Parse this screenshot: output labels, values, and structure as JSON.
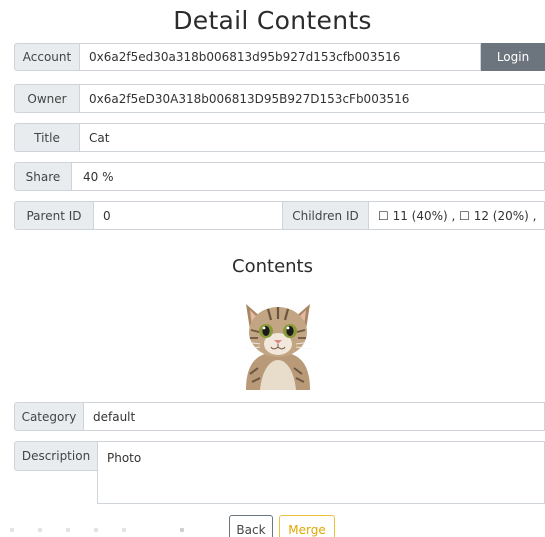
{
  "page": {
    "title": "Detail Contents"
  },
  "account": {
    "label": "Account",
    "value": "0x6a2f5ed30a318b006813d95b927d153cfb003516",
    "login_label": "Login"
  },
  "owner": {
    "label": "Owner",
    "value": "0x6a2f5eD30A318b006813D95B927D153cFb003516"
  },
  "title_field": {
    "label": "Title",
    "value": "Cat"
  },
  "share": {
    "label": "Share",
    "value": "40 %"
  },
  "parent": {
    "label": "Parent ID",
    "value": "0"
  },
  "children": {
    "label": "Children ID",
    "value": "☐ 11 (40%) , ☐ 12 (20%) ,"
  },
  "contents": {
    "heading": "Contents"
  },
  "category": {
    "label": "Category",
    "value": "default"
  },
  "description": {
    "label": "Description",
    "value": "Photo"
  },
  "footer": {
    "back_label": "Back",
    "merge_label": "Merge"
  },
  "colors": {
    "login_bg": "#6c757d",
    "merge_accent": "#f0c040",
    "label_bg": "#e9ecef"
  }
}
